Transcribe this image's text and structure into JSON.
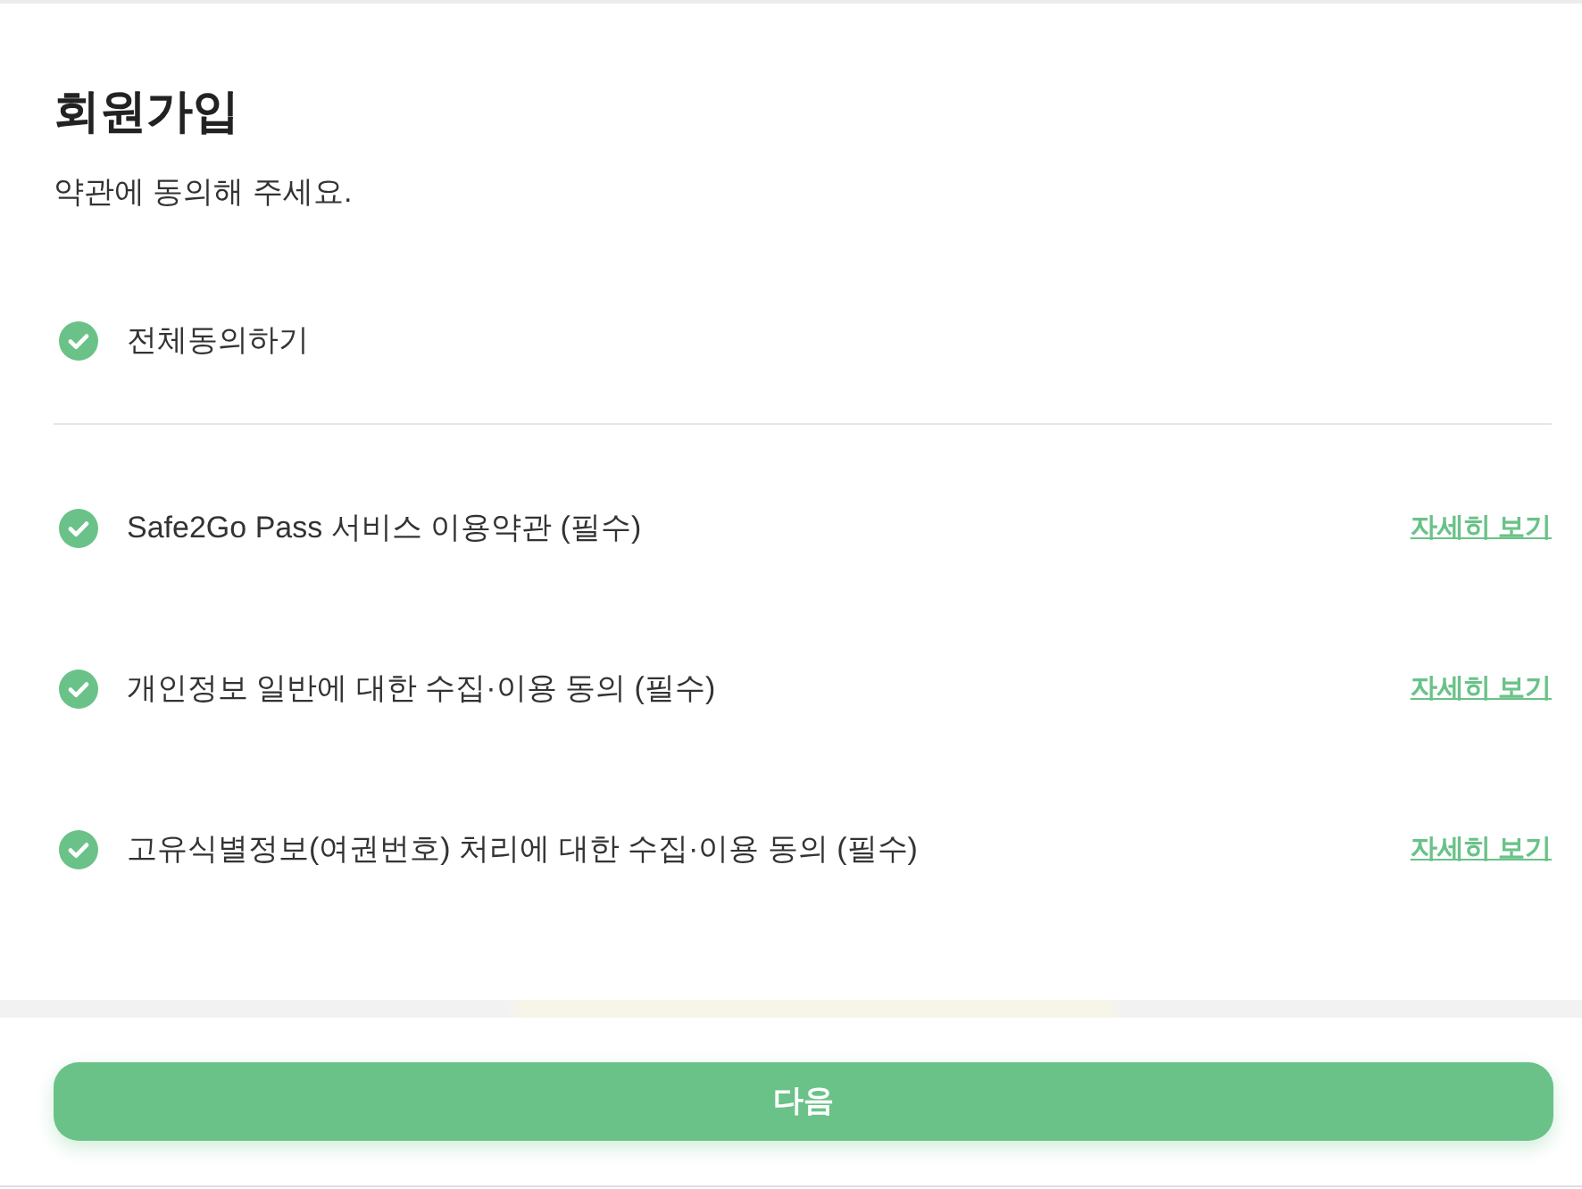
{
  "title": "회원가입",
  "subtitle": "약관에 동의해 주세요.",
  "agree_all": {
    "label": "전체동의하기",
    "checked": true
  },
  "terms": [
    {
      "label": "Safe2Go Pass 서비스 이용약관 (필수)",
      "checked": true,
      "link": "자세히 보기"
    },
    {
      "label": "개인정보 일반에 대한 수집·이용 동의 (필수)",
      "checked": true,
      "link": "자세히 보기"
    },
    {
      "label": "고유식별정보(여권번호) 처리에 대한 수집·이용 동의 (필수)",
      "checked": true,
      "link": "자세히 보기"
    }
  ],
  "next_button": {
    "label": "다음"
  }
}
